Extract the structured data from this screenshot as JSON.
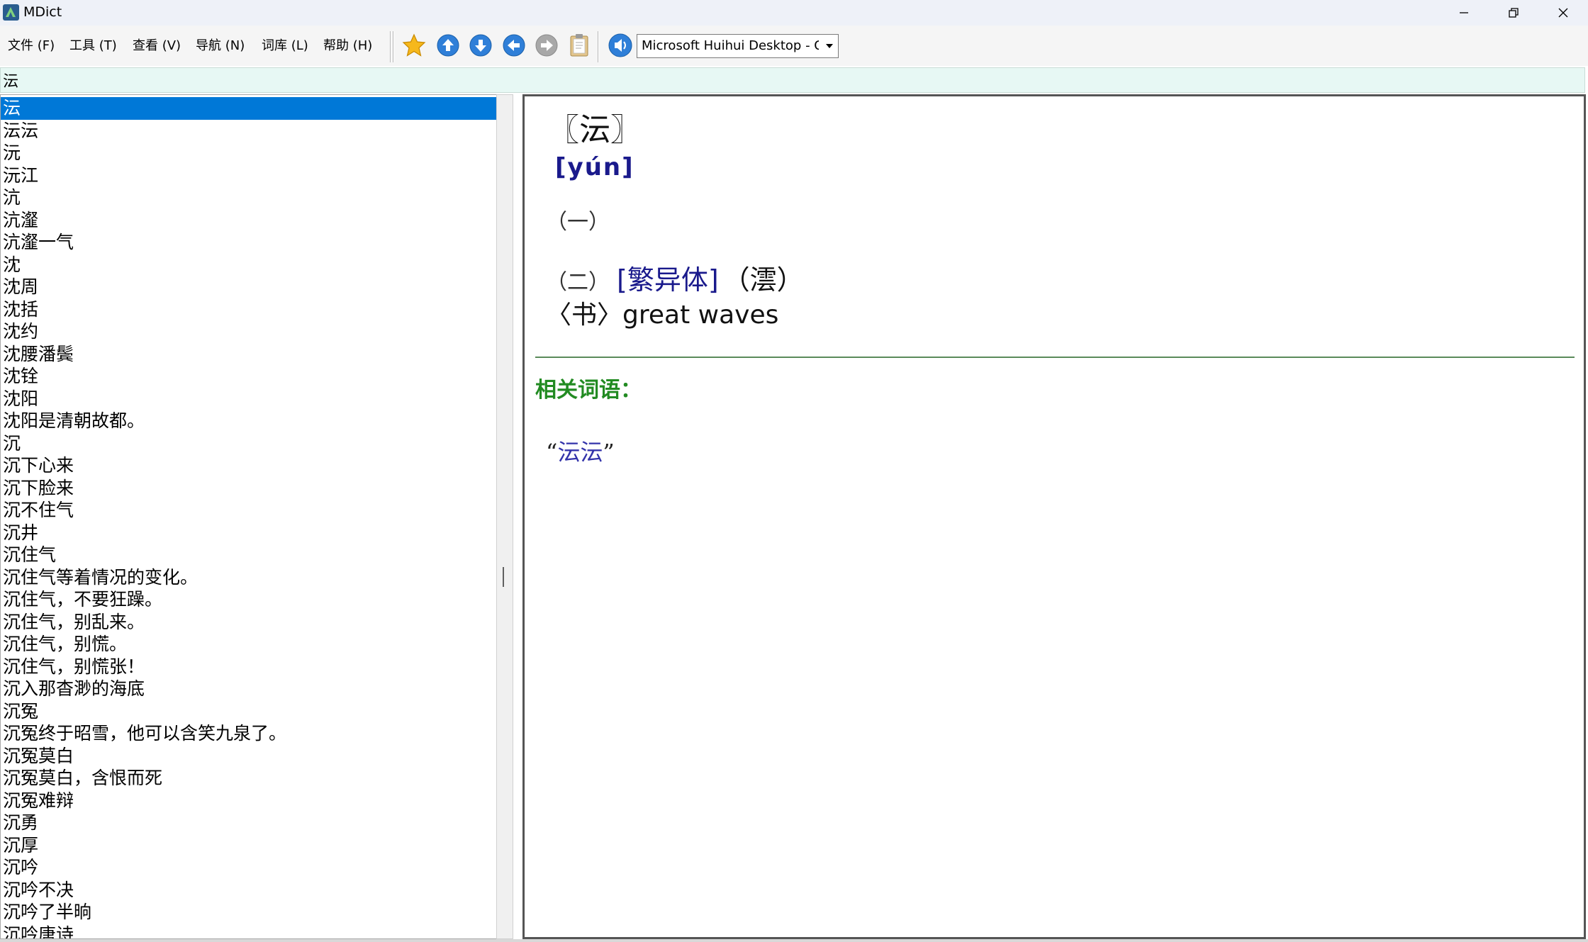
{
  "window": {
    "title": "MDict",
    "icons": {
      "app": "mdict-app-icon",
      "minimize": "minimize-icon",
      "maximize": "restore-icon",
      "close": "close-icon"
    }
  },
  "menu": {
    "file": "文件 (F)",
    "tools": "工具 (T)",
    "view": "查看 (V)",
    "navigate": "导航 (N)",
    "library": "词库 (L)",
    "help": "帮助 (H)"
  },
  "toolbar": {
    "icons": [
      "star-icon",
      "arrow-up-icon",
      "arrow-down-icon",
      "arrow-left-icon",
      "arrow-right-icon",
      "clipboard-icon",
      "speaker-icon"
    ],
    "voice_value": "Microsoft Huihui Desktop - C",
    "voice_arrow_icon": "dropdown-arrow-icon"
  },
  "search": {
    "value": "沄"
  },
  "word_list": {
    "selected_index": 0,
    "items": [
      "沄",
      "沄沄",
      "沅",
      "沅江",
      "沆",
      "沆瀣",
      "沆瀣一气",
      "沈",
      "沈周",
      "沈括",
      "沈约",
      "沈腰潘鬓",
      "沈铨",
      "沈阳",
      "沈阳是清朝故都。",
      "沉",
      "沉下心来",
      "沉下脸来",
      "沉不住气",
      "沉井",
      "沉住气",
      "沉住气等着情况的变化。",
      "沉住气，不要狂躁。",
      "沉住气，别乱来。",
      "沉住气，别慌。",
      "沉住气，别慌张！",
      "沉入那杳渺的海底",
      "沉冤",
      "沉冤终于昭雪，他可以含笑九泉了。",
      "沉冤莫白",
      "沉冤莫白，含恨而死",
      "沉冤难辩",
      "沉勇",
      "沉厚",
      "沉吟",
      "沉吟不决",
      "沉吟了半晌",
      "沉吟唐诗"
    ]
  },
  "definition": {
    "headword": "〖沄〗",
    "pinyin": "[yún]",
    "sense1": "（一）",
    "sense2_num": "（二）",
    "sense2_variant_label": "[繁异体]",
    "sense2_variant_char": "（澐）",
    "gloss_tag": "〈书〉",
    "gloss_text": "great waves",
    "related_title": "相关词语：",
    "related_open": "“",
    "related_word": "沄沄",
    "related_close": "”"
  },
  "colors": {
    "selection": "#0078d7",
    "pinyin": "#1a1a8c",
    "related_title": "#228b22",
    "search_bg": "#e7f8f4"
  }
}
